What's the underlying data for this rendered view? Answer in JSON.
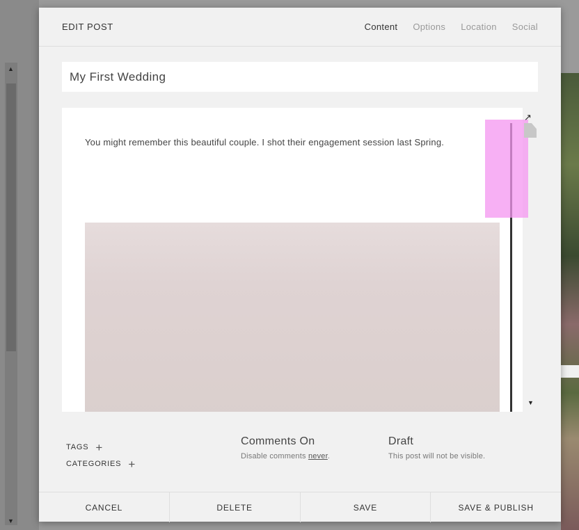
{
  "header": {
    "title": "EDIT POST",
    "tabs": [
      {
        "label": "Content",
        "active": true
      },
      {
        "label": "Options",
        "active": false
      },
      {
        "label": "Location",
        "active": false
      },
      {
        "label": "Social",
        "active": false
      }
    ]
  },
  "post": {
    "title_value": "My First Wedding",
    "body_text": "You might remember this beautiful couple.  I shot their engagement session last Spring."
  },
  "meta": {
    "tags_label": "TAGS",
    "categories_label": "CATEGORIES",
    "comments_heading": "Comments On",
    "comments_sub_prefix": "Disable comments ",
    "comments_sub_link": "never",
    "comments_sub_suffix": ".",
    "status_heading": "Draft",
    "status_sub": "This post will not be visible."
  },
  "footer": {
    "cancel": "CANCEL",
    "delete": "DELETE",
    "save": "SAVE",
    "save_publish": "SAVE & PUBLISH"
  },
  "icons": {
    "delete_image": "trash-icon",
    "expand": "expand-arrow-icon",
    "add": "plus-icon"
  }
}
